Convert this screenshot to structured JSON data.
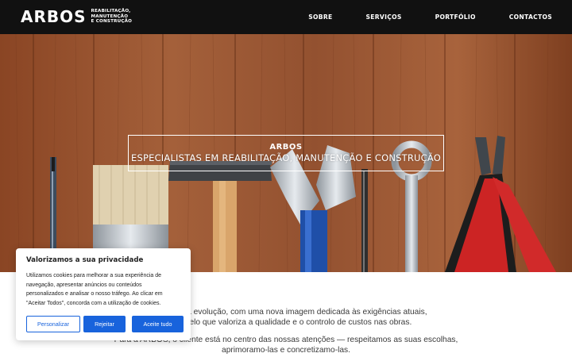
{
  "header": {
    "logo_word": "ARBOS",
    "logo_tagline": [
      "REABILITAÇÃO,",
      "MANUTENÇÃO",
      "E CONSTRUÇÃO"
    ],
    "nav": [
      "SOBRE",
      "SERVIÇOS",
      "PORTFÓLIO",
      "CONTACTOS"
    ]
  },
  "hero": {
    "title": "ARBOS",
    "subtitle": "ESPECIALISTAS EM REABILITAÇÃO, MANUTENÇÃO E CONSTRUÇÃO"
  },
  "intro": {
    "line1": "ta aqui a sua evolução, com uma nova imagem dedicada às exigências atuais,",
    "line2": "um modelo que valoriza a qualidade e o controlo de custos nas obras.",
    "line3": "Para a ARBOS, o cliente está no centro das nossas atenções — respeitamos as suas escolhas,",
    "line4": "aprimoramo-las e concretizamo-las."
  },
  "cookie": {
    "title": "Valorizamos a sua privacidade",
    "text_lines": [
      "Utilizamos cookies para melhorar a sua experiência de",
      "navegação, apresentar anúncios ou conteúdos",
      "personalizados e analisar o nosso tráfego. Ao clicar em",
      "\"Aceitar Todos\", concorda com a utilização de cookies."
    ],
    "customize_label": "Personalizar",
    "reject_label": "Rejeitar",
    "accept_label": "Aceite tudo"
  },
  "colors": {
    "header_bg": "#111111",
    "accent_blue": "#1863dc",
    "wood": "#9a5630"
  }
}
